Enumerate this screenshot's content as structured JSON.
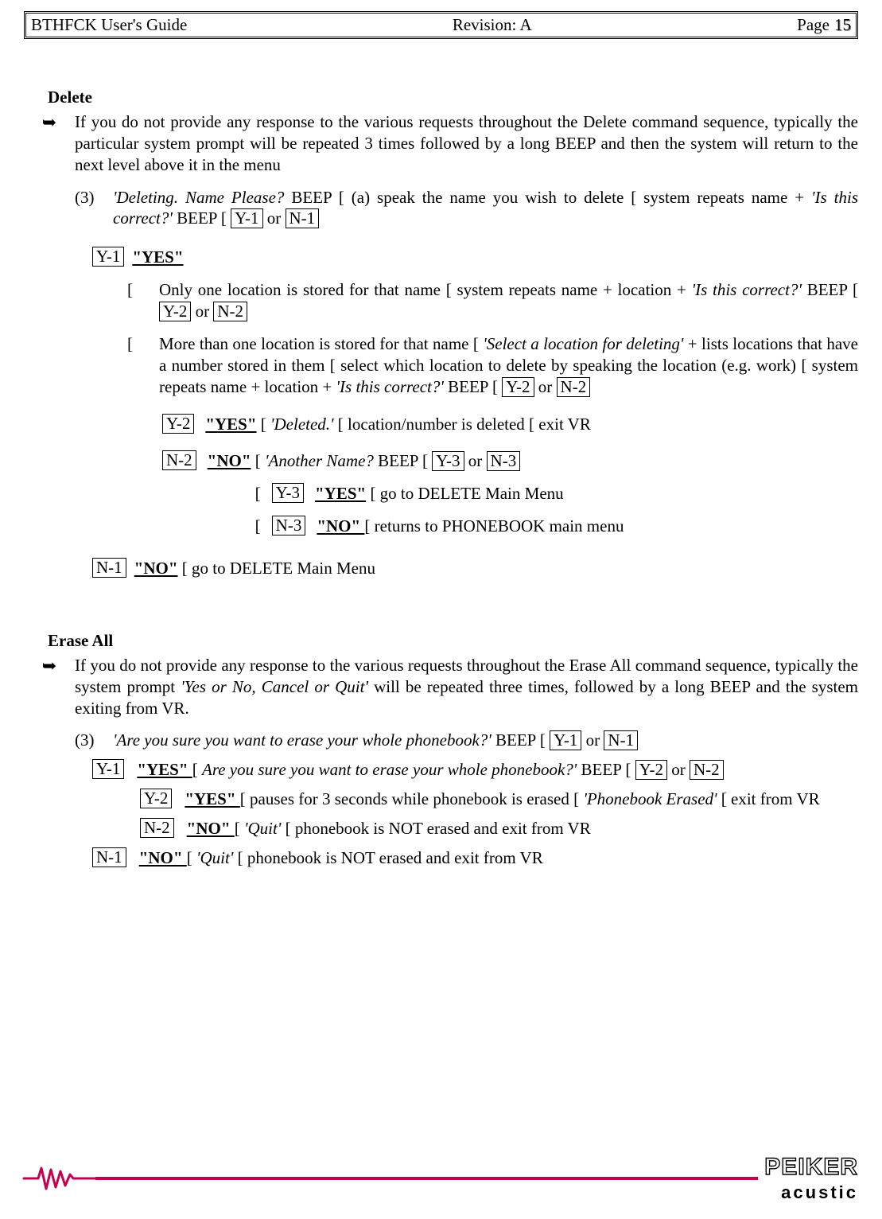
{
  "header": {
    "title": "BTHFCK  User's Guide",
    "revision": "Revision: A",
    "page_label": "Page",
    "page_num": "15"
  },
  "delete": {
    "heading": "Delete",
    "intro": "If you do not provide any response to the various requests throughout the Delete command sequence, typically the particular system prompt will be repeated 3 times followed by a long BEEP and then the system will return to the next level above it in the menu",
    "step_num": "(3)",
    "step_a": "'Deleting.   Name Please?",
    "step_b": " BEEP [ (a) speak the name you wish to delete [ system repeats name + ",
    "step_c": "'Is this correct?'",
    "step_d": "  BEEP [ ",
    "y1": "Y-1",
    "n1": "N-1",
    "or": " or ",
    "y1_word": "\"YES\"",
    "sub1_a": "Only one location is stored for that name [ system repeats name + location + ",
    "sub1_b": "'Is this correct?'",
    "sub1_c": " BEEP [ ",
    "y2": "Y-2",
    "n2": "N-2",
    "sub2_a": "More than one location is stored for that name [ ",
    "sub2_b": "'Select a location for deleting'",
    "sub2_c": " + lists locations that have a number stored in them [ select which location to delete by speaking the location (e.g. work) [ system repeats name + location + ",
    "sub2_d": "'Is this correct?'",
    "sub2_e": " BEEP [ ",
    "y2_word": "\"YES\"",
    "y2_line_a": " [ ",
    "y2_line_b": "'Deleted.'",
    "y2_line_c": " [ location/number is deleted [ exit VR",
    "n2_word": "\"NO\"",
    "n2_line_a": " [ ",
    "n2_line_b": "'Another Name?",
    "n2_line_c": " BEEP [ ",
    "y3": "Y-3",
    "n3": "N-3",
    "y3_word": "\"YES\"",
    "y3_line": " [ go to DELETE Main Menu",
    "n3_word": "\"NO\" ",
    "n3_line": "[ returns to PHONEBOOK main menu",
    "n1_word": "\"NO\"",
    "n1_line": " [ go to DELETE Main Menu"
  },
  "erase": {
    "heading": "Erase All",
    "intro_a": "If you do not provide any response to the various requests throughout the Erase All command sequence, typically the system prompt ",
    "intro_b": "'Yes or No, Cancel or Quit'",
    "intro_c": " will be repeated three times, followed by a long BEEP and the system exiting from VR.",
    "step_num": "(3)",
    "q": "'Are you sure you want to erase your whole phonebook?'",
    "beep": " BEEP [ ",
    "y1": "Y-1",
    "n1": "N-1",
    "y2": "Y-2",
    "n2": "N-2",
    "or": " or ",
    "y1_word": "\"YES\" ",
    "y1_a": "[ ",
    "y1_b": "Are you sure you want to erase your whole phonebook?'",
    "y1_c": " BEEP [ ",
    "y2_word": "\"YES\" ",
    "y2_a": "[ pauses for 3 seconds while phonebook is erased [ ",
    "y2_b": "'Phonebook Erased'",
    "y2_c": " [ exit from VR",
    "n2_word": "\"NO\" ",
    "n2_a": "[ ",
    "n2_b": "'Quit'",
    "n2_c": " [ phonebook is NOT erased and exit from VR",
    "n1_word": "\"NO\" ",
    "n1_a": "[ ",
    "n1_b": "'Quit'",
    "n1_c": " [ phonebook is NOT erased and exit from VR"
  },
  "footer": {
    "brand_top": "PEIKER",
    "brand_bottom": "acustic"
  },
  "sym": {
    "hand": "➥",
    "arrow": "["
  }
}
